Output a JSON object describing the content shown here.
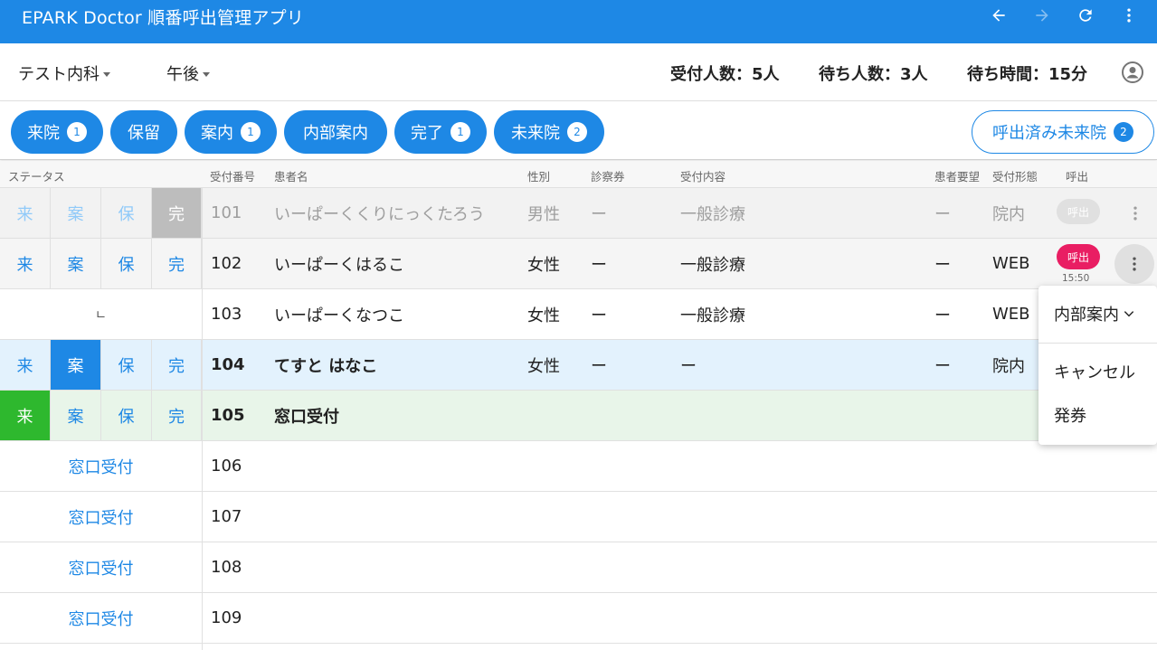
{
  "appbar": {
    "title": "EPARK Doctor 順番呼出管理アプリ",
    "accent": "#1e88e5"
  },
  "filters": {
    "department": "テスト内科",
    "session": "午後"
  },
  "stats": {
    "reception": "受付人数：5人",
    "waiting": "待ち人数：3人",
    "wait_time": "待ち時間：15分"
  },
  "tabs": [
    {
      "label": "来院",
      "badge": "1"
    },
    {
      "label": "保留",
      "badge": ""
    },
    {
      "label": "案内",
      "badge": "1"
    },
    {
      "label": "内部案内",
      "badge": ""
    },
    {
      "label": "完了",
      "badge": "1"
    },
    {
      "label": "未来院",
      "badge": "2"
    }
  ],
  "called_tab": {
    "label": "呼出済み未来院",
    "badge": "2"
  },
  "columns": {
    "status": "ステータス",
    "number": "受付番号",
    "name": "患者名",
    "gender": "性別",
    "ticket": "診察券",
    "content": "受付内容",
    "request": "患者要望",
    "type": "受付形態",
    "call": "呼出"
  },
  "status_buttons": [
    "来",
    "案",
    "保",
    "完"
  ],
  "rows": [
    {
      "number": "101",
      "name": "いーぱーくくりにっくたろう",
      "gender": "男性",
      "ticket": "ー",
      "content": "一般診療",
      "request": "ー",
      "type": "院内",
      "call": "呼出"
    },
    {
      "number": "102",
      "name": "いーぱーくはるこ",
      "gender": "女性",
      "ticket": "ー",
      "content": "一般診療",
      "request": "ー",
      "type": "WEB",
      "call": "呼出",
      "call_time": "15:50"
    },
    {
      "number": "103",
      "name": "いーぱーくなつこ",
      "gender": "女性",
      "ticket": "ー",
      "content": "一般診療",
      "request": "ー",
      "type": "WEB",
      "sub_mark": "ㄴ"
    },
    {
      "number": "104",
      "name": "てすと はなこ",
      "gender": "女性",
      "ticket": "ー",
      "content": "ー",
      "request": "ー",
      "type": "院内"
    },
    {
      "number": "105",
      "name": "窓口受付"
    }
  ],
  "empty_rows": [
    {
      "label": "窓口受付",
      "number": "106"
    },
    {
      "label": "窓口受付",
      "number": "107"
    },
    {
      "label": "窓口受付",
      "number": "108"
    },
    {
      "label": "窓口受付",
      "number": "109"
    }
  ],
  "popup_menu": {
    "selected": "内部案内",
    "items": [
      "キャンセル",
      "発券"
    ]
  }
}
